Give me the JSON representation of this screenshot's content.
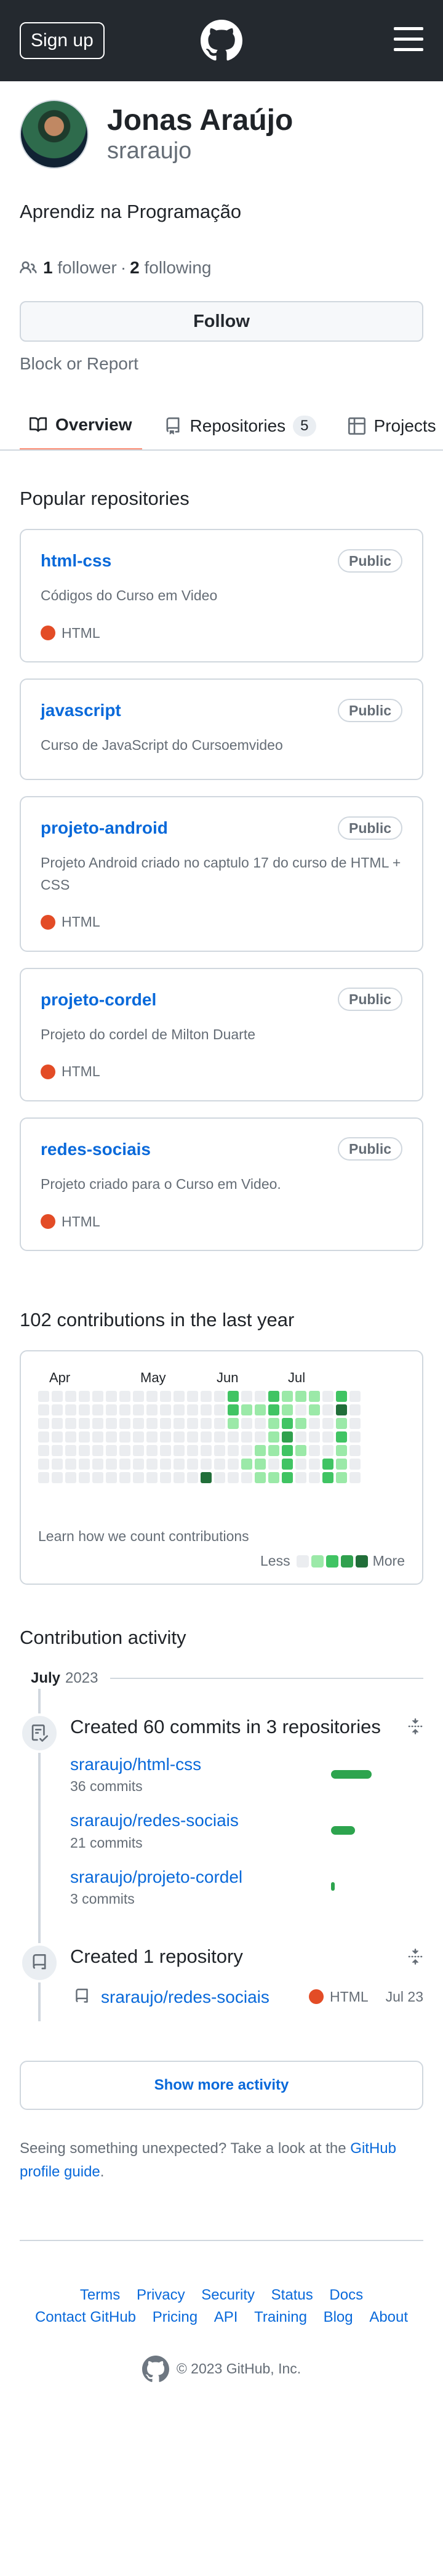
{
  "header": {
    "signup_label": "Sign up"
  },
  "profile": {
    "full_name": "Jonas Araújo",
    "login": "sraraujo",
    "bio": "Aprendiz na Programação",
    "followers_count": "1",
    "followers_label": "follower",
    "separator": "·",
    "following_count": "2",
    "following_label": "following",
    "follow_label": "Follow",
    "block_label": "Block or Report"
  },
  "tabs": [
    {
      "label": "Overview"
    },
    {
      "label": "Repositories",
      "count": "5"
    },
    {
      "label": "Projects"
    }
  ],
  "popular": {
    "title": "Popular repositories",
    "repos": [
      {
        "name": "html-css",
        "visibility": "Public",
        "description": "Códigos do Curso em Video",
        "language": "HTML"
      },
      {
        "name": "javascript",
        "visibility": "Public",
        "description": "Curso de JavaScript do Cursoemvideo",
        "language": ""
      },
      {
        "name": "projeto-android",
        "visibility": "Public",
        "description": "Projeto Android criado no captulo 17 do curso de HTML + CSS",
        "language": "HTML"
      },
      {
        "name": "projeto-cordel",
        "visibility": "Public",
        "description": "Projeto do cordel de Milton Duarte",
        "language": "HTML"
      },
      {
        "name": "redes-sociais",
        "visibility": "Public",
        "description": "Projeto criado para o Curso em Video.",
        "language": "HTML"
      }
    ]
  },
  "contributions": {
    "title": "102 contributions in the last year",
    "months": [
      "Apr",
      "May",
      "Jun",
      "Jul"
    ],
    "learn_label": "Learn how we count contributions",
    "less_label": "Less",
    "more_label": "More",
    "colors": [
      "#ebedf0",
      "#9be9a8",
      "#40c463",
      "#30a14e",
      "#216e39"
    ],
    "levels": [
      [
        0,
        0,
        0,
        0,
        0,
        0,
        0
      ],
      [
        0,
        0,
        0,
        0,
        0,
        0,
        0
      ],
      [
        0,
        0,
        0,
        0,
        0,
        0,
        0
      ],
      [
        0,
        0,
        0,
        0,
        0,
        0,
        0
      ],
      [
        0,
        0,
        0,
        0,
        0,
        0,
        0
      ],
      [
        0,
        0,
        0,
        0,
        0,
        0,
        0
      ],
      [
        0,
        0,
        0,
        0,
        0,
        0,
        0
      ],
      [
        0,
        0,
        0,
        0,
        0,
        0,
        0
      ],
      [
        0,
        0,
        0,
        0,
        0,
        0,
        0
      ],
      [
        0,
        0,
        0,
        0,
        0,
        0,
        0
      ],
      [
        0,
        0,
        0,
        0,
        0,
        0,
        0
      ],
      [
        0,
        0,
        0,
        0,
        0,
        0,
        0
      ],
      [
        0,
        0,
        0,
        0,
        0,
        0,
        4
      ],
      [
        0,
        0,
        0,
        0,
        0,
        0,
        0
      ],
      [
        2,
        2,
        1,
        0,
        0,
        0,
        0
      ],
      [
        0,
        1,
        0,
        0,
        0,
        1,
        0
      ],
      [
        0,
        1,
        0,
        0,
        1,
        1,
        1
      ],
      [
        2,
        2,
        1,
        1,
        1,
        0,
        1
      ],
      [
        1,
        1,
        2,
        3,
        2,
        2,
        2
      ],
      [
        1,
        0,
        1,
        0,
        1,
        0,
        0
      ],
      [
        1,
        1,
        0,
        0,
        0,
        0,
        0
      ],
      [
        0,
        0,
        0,
        0,
        0,
        2,
        2
      ],
      [
        2,
        4,
        1,
        2,
        1,
        1,
        1
      ],
      [
        0,
        0,
        0,
        0,
        0,
        0,
        0
      ]
    ]
  },
  "activity": {
    "title": "Contribution activity",
    "month": "July",
    "year": "2023",
    "commits_title": "Created 60 commits in 3 repositories",
    "commit_repos": [
      {
        "name": "sraraujo/html-css",
        "count": "36 commits",
        "fraction": 0.6
      },
      {
        "name": "sraraujo/redes-sociais",
        "count": "21 commits",
        "fraction": 0.35
      },
      {
        "name": "sraraujo/projeto-cordel",
        "count": "3 commits",
        "fraction": 0.05
      }
    ],
    "repo_title": "Created 1 repository",
    "created_repo": {
      "name": "sraraujo/redes-sociais",
      "language": "HTML",
      "date": "Jul 23"
    },
    "show_more_label": "Show more activity",
    "unexpected_text": "Seeing something unexpected? Take a look at the ",
    "guide_link": "GitHub profile guide",
    "guide_end": "."
  },
  "footer": {
    "links": [
      "Terms",
      "Privacy",
      "Security",
      "Status",
      "Docs",
      "Contact GitHub",
      "Pricing",
      "API",
      "Training",
      "Blog",
      "About"
    ],
    "copyright": "© 2023 GitHub, Inc."
  }
}
